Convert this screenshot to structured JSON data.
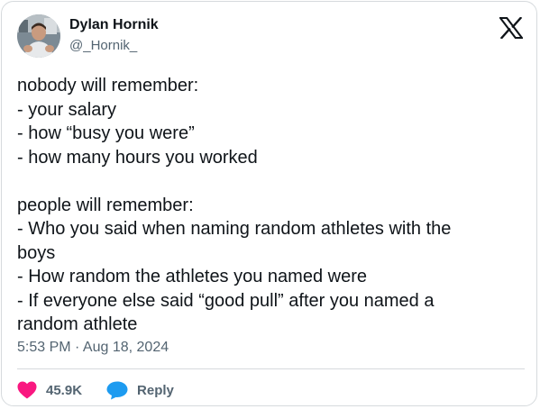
{
  "author": {
    "name": "Dylan Hornik",
    "handle": "@_Hornik_"
  },
  "platform_icon": "x-logo-icon",
  "tweet": {
    "lines": [
      "nobody will remember:",
      "- your salary",
      "- how “busy you were”",
      "- how many hours you worked",
      "",
      "people will remember:",
      "- Who you said when naming random athletes with the",
      "boys",
      "- How random the athletes you named were",
      "- If everyone else said “good pull” after you named a",
      "random athlete"
    ],
    "timestamp": "5:53 PM · Aug 18, 2024"
  },
  "actions": {
    "like_icon": "heart-icon",
    "like_count": "45.9K",
    "reply_icon": "speech-bubble-icon",
    "reply_label": "Reply"
  },
  "colors": {
    "text": "#0f1419",
    "secondary": "#536471",
    "heart": "#f91880",
    "reply_bubble": "#1d9bf0",
    "border": "#d6dadd"
  }
}
